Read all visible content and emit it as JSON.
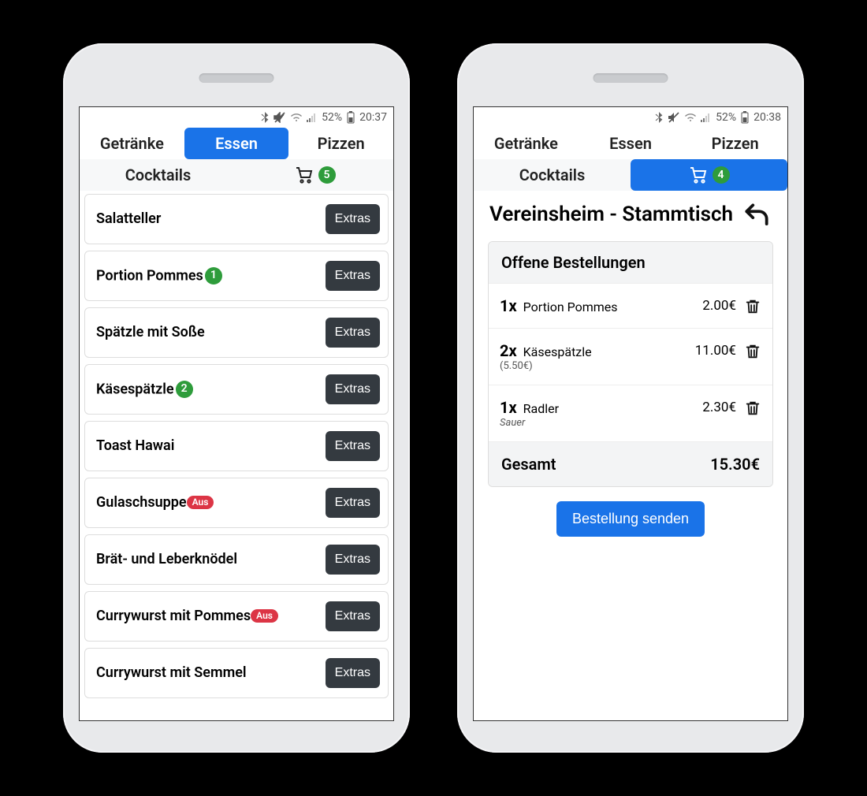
{
  "left": {
    "statusbar": {
      "percent": "52%",
      "time": "20:37"
    },
    "tabs": [
      "Getränke",
      "Essen",
      "Pizzen"
    ],
    "active_tab_index": 1,
    "subtab": "Cocktails",
    "cart_count": "5",
    "extras_label": "Extras",
    "items": [
      {
        "name": "Salatteller",
        "count": null,
        "out": false
      },
      {
        "name": "Portion Pommes",
        "count": "1",
        "out": false
      },
      {
        "name": "Spätzle mit Soße",
        "count": null,
        "out": false
      },
      {
        "name": "Käsespätzle",
        "count": "2",
        "out": false
      },
      {
        "name": "Toast Hawai",
        "count": null,
        "out": false
      },
      {
        "name": "Gulaschsuppe",
        "count": null,
        "out": true,
        "out_label": "Aus"
      },
      {
        "name": "Brät- und Leberknödel",
        "count": null,
        "out": false
      },
      {
        "name": "Currywurst mit Pommes",
        "count": null,
        "out": true,
        "out_label": "Aus"
      },
      {
        "name": "Currywurst mit Semmel",
        "count": null,
        "out": false
      }
    ]
  },
  "right": {
    "statusbar": {
      "percent": "52%",
      "time": "20:38"
    },
    "tabs": [
      "Getränke",
      "Essen",
      "Pizzen"
    ],
    "subtab": "Cocktails",
    "cart_count": "4",
    "title": "Vereinsheim - Stammtisch",
    "orders_heading": "Offene Bestellungen",
    "orders": [
      {
        "qty": "1",
        "name": "Portion Pommes",
        "sub": "",
        "price": "2.00€"
      },
      {
        "qty": "2",
        "name": "Käsespätzle",
        "sub": "(5.50€)",
        "price": "11.00€"
      },
      {
        "qty": "1",
        "name": "Radler",
        "sub": "Sauer",
        "sub_italic": true,
        "price": "2.30€"
      }
    ],
    "total_label": "Gesamt",
    "total_value": "15.30€",
    "send_label": "Bestellung senden"
  }
}
